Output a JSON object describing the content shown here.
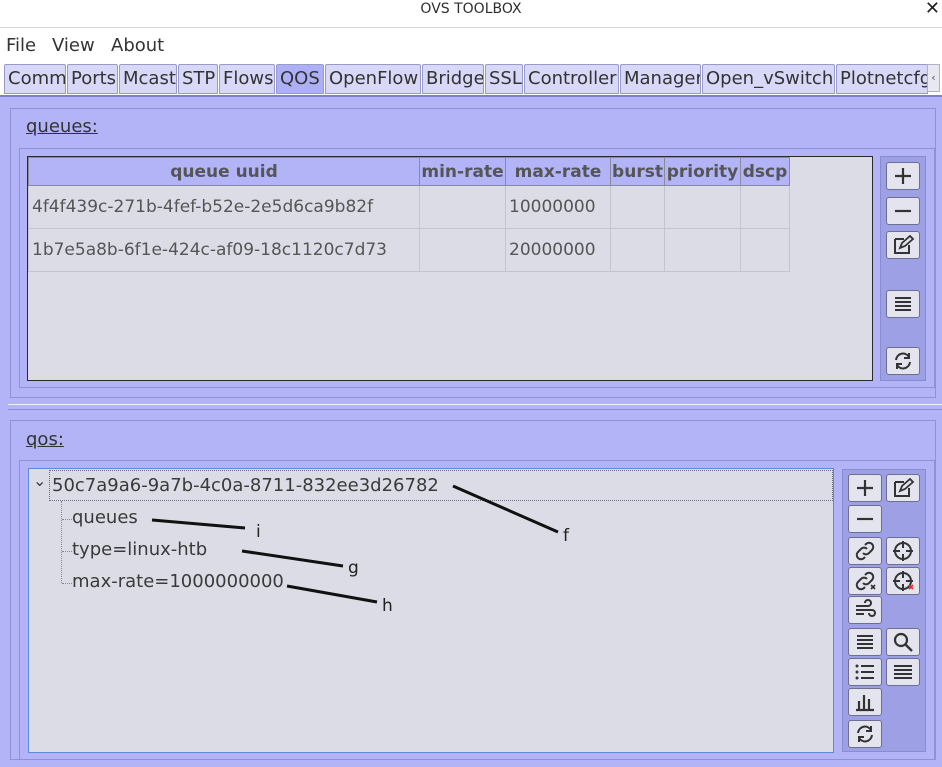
{
  "window": {
    "title": "OVS TOOLBOX",
    "close_glyph": "✕"
  },
  "menu": {
    "items": [
      "File",
      "View",
      "About"
    ]
  },
  "tabs": {
    "items": [
      "Comm",
      "Ports",
      "Mcast",
      "STP",
      "Flows",
      "QOS",
      "OpenFlow",
      "Bridge",
      "SSL",
      "Controller",
      "Manager",
      "Open_vSwitch",
      "Plotnetcfg"
    ],
    "active": "QOS",
    "scroll_glyph": "‹"
  },
  "queues": {
    "title": "queues:",
    "columns": [
      "queue uuid",
      "min-rate",
      "max-rate",
      "burst",
      "priority",
      "dscp"
    ],
    "rows": [
      [
        "4f4f439c-271b-4fef-b52e-2e5d6ca9b82f",
        "",
        "10000000",
        "",
        "",
        ""
      ],
      [
        "1b7e5a8b-6f1e-424c-af09-18c1120c7d73",
        "",
        "20000000",
        "",
        "",
        ""
      ]
    ],
    "buttons": [
      "add-icon",
      "remove-icon",
      "edit-icon",
      "list-icon",
      "refresh-icon"
    ]
  },
  "qos": {
    "title": "qos:",
    "root": "50c7a9a6-9a7b-4c0a-8711-832ee3d26782",
    "expand_glyph": "⌄",
    "children": [
      "queues",
      "type=linux-htb",
      "max-rate=1000000000"
    ],
    "buttons": [
      "add-icon",
      "edit-icon",
      "remove-icon",
      "link-icon",
      "crosshair-icon",
      "unlink-icon",
      "crosshair-remove-icon",
      "wind-icon",
      "list-icon",
      "search-icon",
      "bullet-list-icon",
      "align-icon",
      "bar-chart-icon",
      "refresh-icon"
    ]
  },
  "annotations": [
    "f",
    "g",
    "h",
    "i"
  ]
}
